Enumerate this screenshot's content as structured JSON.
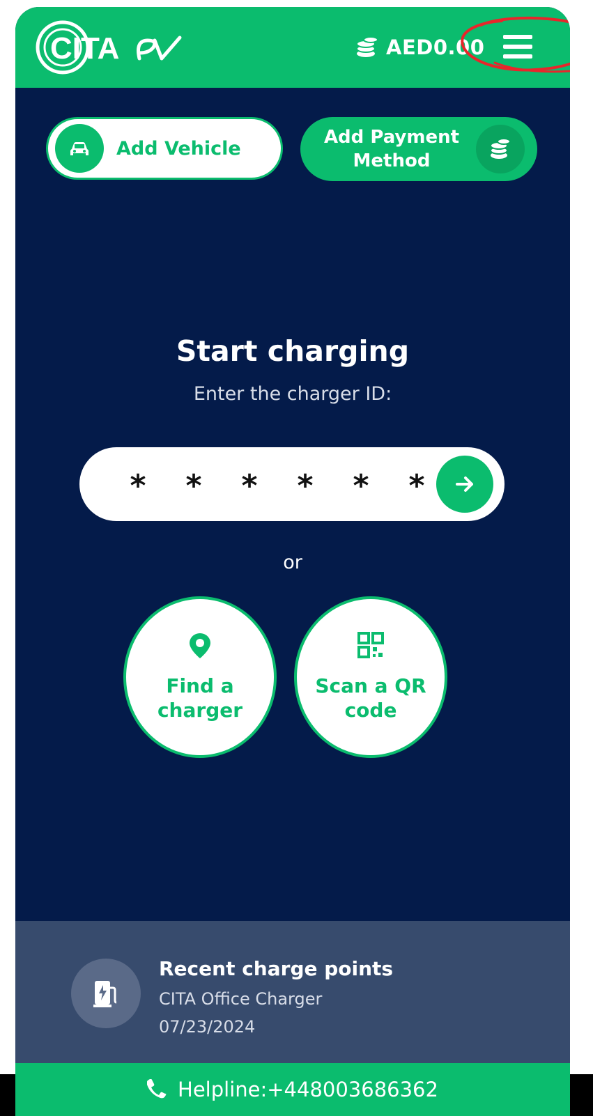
{
  "header": {
    "logo_text": "CITA ev",
    "balance": "AED0.00",
    "balance_icon": "coins-icon",
    "menu_icon": "hamburger-menu-icon"
  },
  "actions": {
    "add_vehicle_label": "Add Vehicle",
    "add_vehicle_icon": "car-icon",
    "add_payment_label": "Add Payment Method",
    "add_payment_icon": "coins-icon"
  },
  "charging": {
    "title": "Start charging",
    "subtitle": "Enter the charger ID:",
    "id_placeholder": [
      "*",
      "*",
      "*",
      "*",
      "*",
      "*"
    ],
    "submit_icon": "arrow-right-icon",
    "or_label": "or",
    "find_label": "Find a charger",
    "find_icon": "map-pin-icon",
    "scan_label": "Scan a QR code",
    "scan_icon": "qr-code-icon"
  },
  "recent": {
    "title": "Recent charge points",
    "name": "CITA Office Charger",
    "date": "07/23/2024",
    "icon": "ev-charger-icon"
  },
  "footer": {
    "helpline": "Helpline:+448003686362",
    "icon": "phone-icon"
  },
  "colors": {
    "green": "#0bbc6e",
    "navy": "#041b4a",
    "recent_bg": "#374b6d",
    "annotation_red": "#e8262b"
  }
}
